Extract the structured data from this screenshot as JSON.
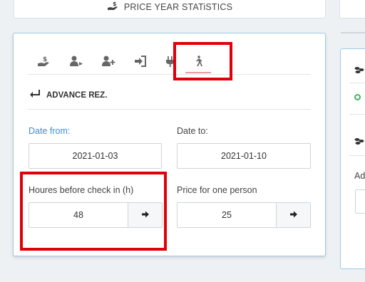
{
  "header": {
    "title": "PRICE YEAR STATiSTICS",
    "icon": "hand-money-icon"
  },
  "tabs": [
    {
      "icon": "hand-money-icon"
    },
    {
      "icon": "user-arrow-icon"
    },
    {
      "icon": "user-plus-icon"
    },
    {
      "icon": "sign-in-icon"
    },
    {
      "icon": "plug-icon"
    },
    {
      "icon": "walking-person-icon",
      "active": true
    }
  ],
  "section": {
    "title": "ADVANCE REZ.",
    "icon": "return-arrow-icon"
  },
  "form": {
    "date_from_label": "Date from:",
    "date_from_value": "2021-01-03",
    "date_to_label": "Date to:",
    "date_to_value": "2021-01-10",
    "hours_label": "Houres before check in (h)",
    "hours_value": "48",
    "price_label": "Price for one person",
    "price_value": "25"
  },
  "right_panel": {
    "text": "Ad"
  },
  "colors": {
    "accent_blue": "#3a8fd6",
    "highlight_red": "#e0000a",
    "tab_active_underline": "#e89aa4",
    "status_green": "#3fb65e"
  }
}
